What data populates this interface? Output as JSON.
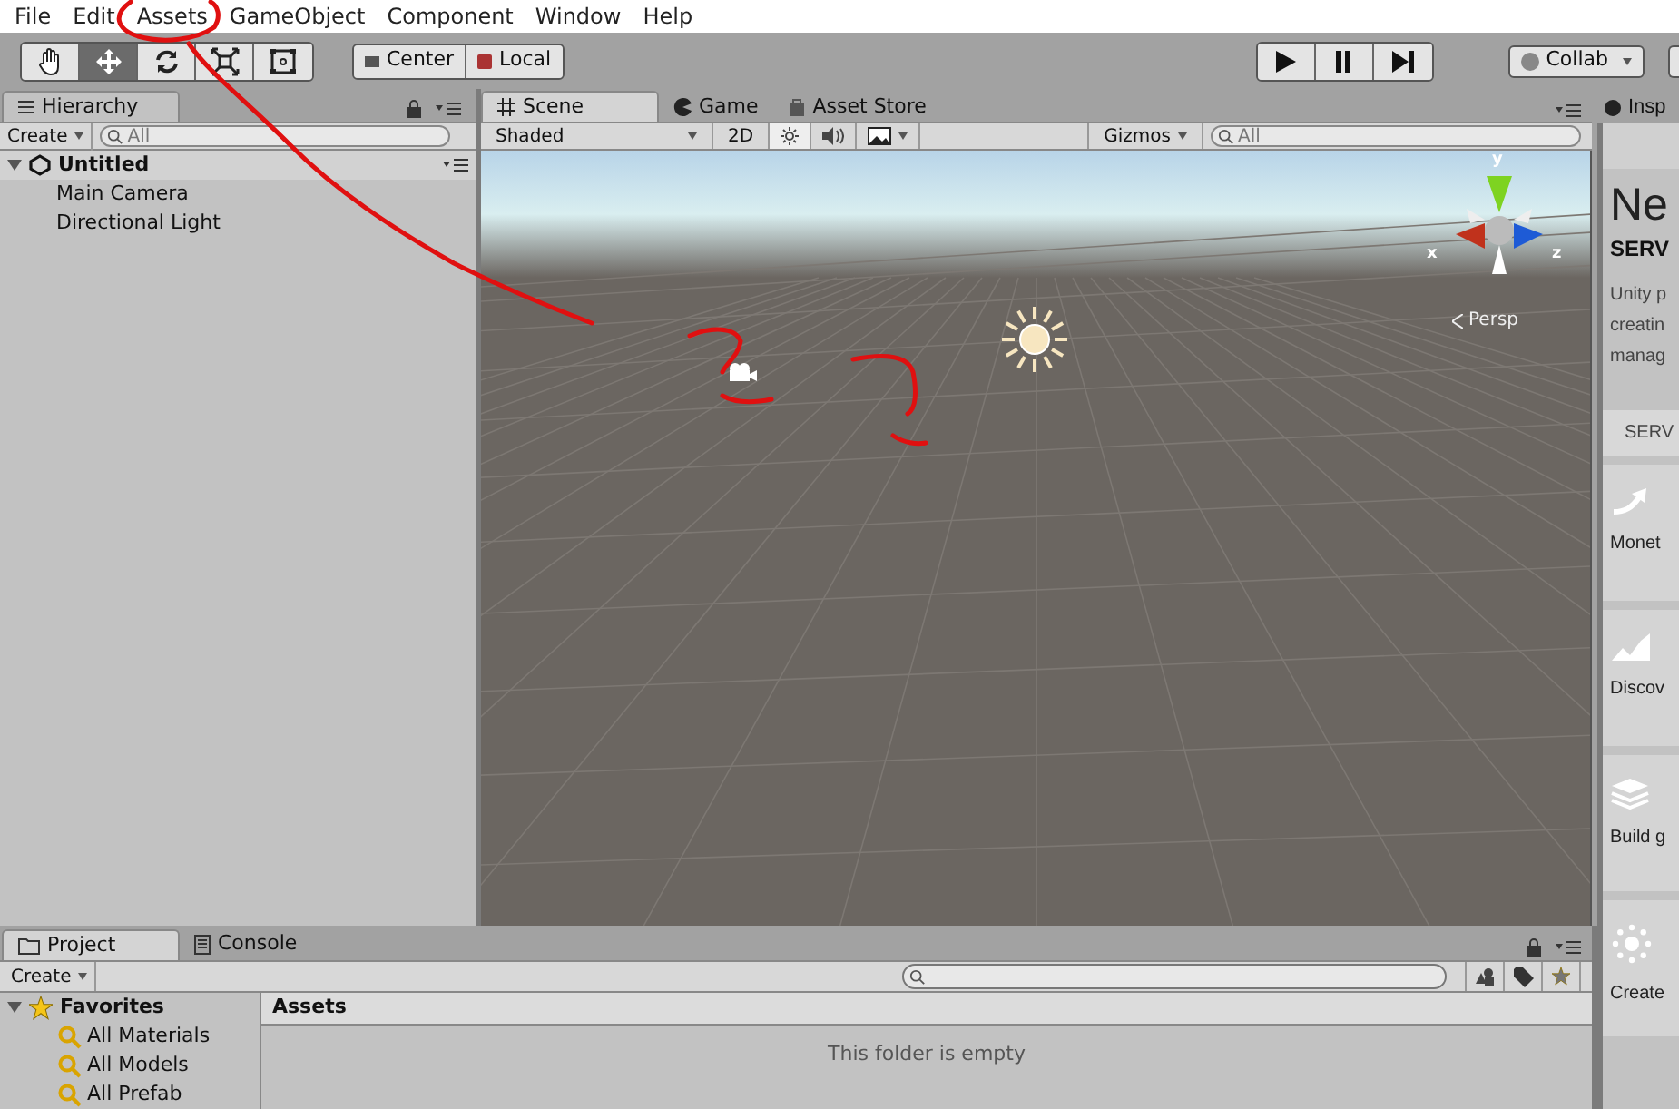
{
  "menu": [
    "File",
    "Edit",
    "Assets",
    "GameObject",
    "Component",
    "Window",
    "Help"
  ],
  "toolbar": {
    "tools": [
      {
        "kind": "hand",
        "selected": false
      },
      {
        "kind": "move",
        "selected": true
      },
      {
        "kind": "rotate",
        "selected": false
      },
      {
        "kind": "scale",
        "selected": false
      },
      {
        "kind": "rect",
        "selected": false
      }
    ],
    "pivot": [
      "Center",
      "Local"
    ],
    "collab": "Collab"
  },
  "hierarchy": {
    "tab": "Hierarchy",
    "create": "Create",
    "search_placeholder": "All",
    "scene": "Untitled",
    "expanded": true,
    "items": [
      "Main Camera",
      "Directional Light"
    ]
  },
  "scene_view": {
    "tabs": [
      {
        "label": "Scene",
        "kind": "scene",
        "selected": true
      },
      {
        "label": "Game",
        "kind": "game",
        "selected": false
      },
      {
        "label": "Asset Store",
        "kind": "store",
        "selected": false
      }
    ],
    "shading": "Shaded",
    "mode_2d": "2D",
    "gizmos": "Gizmos",
    "search_placeholder": "All",
    "projection": "Persp",
    "axes": {
      "x": "x",
      "y": "y",
      "z": "z"
    }
  },
  "inspector": {
    "tab": "Insp",
    "heading": "Ne",
    "subheading": "SERV",
    "lines": [
      "Unity p",
      "creatin",
      "manag"
    ],
    "section_tab": "SERV",
    "cards": [
      {
        "kind": "arrow",
        "label": "Monet"
      },
      {
        "kind": "chart",
        "label": "Discov"
      },
      {
        "kind": "layers",
        "label": "Build g"
      },
      {
        "kind": "burst",
        "label": "Create"
      }
    ]
  },
  "project": {
    "tabs": [
      {
        "label": "Project",
        "selected": true
      },
      {
        "label": "Console",
        "selected": false
      }
    ],
    "create": "Create",
    "favorites": "Favorites",
    "expanded": true,
    "items": [
      "All Materials",
      "All Models",
      "All Prefab"
    ],
    "breadcrumb": "Assets",
    "empty_message": "This folder is empty"
  }
}
